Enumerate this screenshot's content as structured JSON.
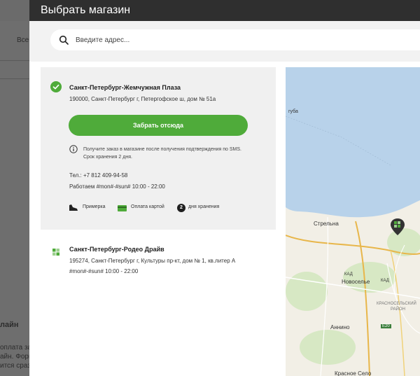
{
  "background": {
    "nav_text": "Всего",
    "lines": [
      "лайн",
      "оплата зака",
      "айн. Форма",
      "ится сразу"
    ]
  },
  "modal": {
    "title": "Выбрать магазин",
    "search": {
      "placeholder": "Введите адрес..."
    }
  },
  "stores": [
    {
      "name": "Санкт-Петербург-Жемчужная Плаза",
      "address": "190000, Санкт-Петербург г, Петергофское ш, дом № 51а",
      "button_label": "Забрать отсюда",
      "note_lines": [
        "Получите заказ в магазине после получения подтверждения по SMS.",
        "Срок хранения 2 дня."
      ],
      "phone": "Тел.: +7 812 409-94-58",
      "hours": "Работаем #mon#-#sun# 10:00 - 22:00",
      "features": [
        "Примерка",
        "Оплата картой",
        "дня хранения"
      ],
      "storage_days": "2",
      "selected": true
    },
    {
      "name": "Санкт-Петербург-Родео Драйв",
      "address": "195274, Санкт-Петербург г, Культуры пр-кт, дом № 1, кв.литер А",
      "hours": "#mon#-#sun# 10:00 - 22:00",
      "selected": false
    }
  ],
  "map": {
    "labels": [
      "губа",
      "Стрельна",
      "КАД",
      "Новоселье",
      "КАД",
      "КРАСНОСЕЛЬСКИЙ",
      "РАЙОН",
      "Аннино",
      "E20",
      "Красное Село"
    ]
  },
  "colors": {
    "accent": "#4fab3a",
    "header": "#2f2f2f",
    "water": "#b8d2ea",
    "land": "#f2efe6"
  }
}
